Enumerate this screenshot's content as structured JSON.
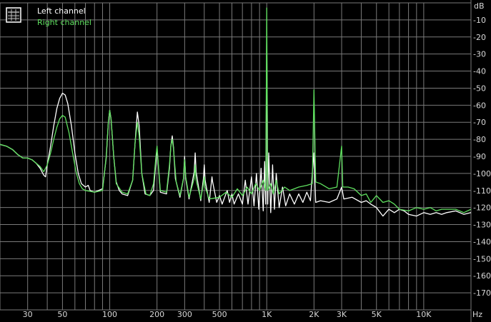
{
  "chart_data": {
    "type": "line",
    "xlabel": "Hz",
    "ylabel": "dB",
    "xscale": "log",
    "xlim": [
      20,
      20000
    ],
    "ylim": [
      -180,
      0
    ],
    "x_ticks": [
      {
        "value": 30,
        "label": "30"
      },
      {
        "value": 50,
        "label": "50"
      },
      {
        "value": 100,
        "label": "100"
      },
      {
        "value": 200,
        "label": "200"
      },
      {
        "value": 300,
        "label": "300"
      },
      {
        "value": 500,
        "label": "500"
      },
      {
        "value": 1000,
        "label": "1K"
      },
      {
        "value": 2000,
        "label": "2K"
      },
      {
        "value": 3000,
        "label": "3K"
      },
      {
        "value": 5000,
        "label": "5K"
      },
      {
        "value": 10000,
        "label": "10K"
      }
    ],
    "y_ticks": [
      -10,
      -20,
      -30,
      -40,
      -50,
      -60,
      -70,
      -80,
      -90,
      -100,
      -110,
      -120,
      -130,
      -140,
      -150,
      -160,
      -170
    ],
    "grid": true,
    "legend_position": "top-left",
    "legend_icon": "window-icon",
    "background_color": "#000000",
    "grid_color": "#7a7a7a",
    "series": [
      {
        "name": "Left channel",
        "color": "#ffffff",
        "points": [
          [
            20,
            -83
          ],
          [
            22,
            -84
          ],
          [
            24,
            -86
          ],
          [
            26,
            -89
          ],
          [
            28,
            -91
          ],
          [
            30,
            -91
          ],
          [
            32,
            -92
          ],
          [
            34,
            -94
          ],
          [
            36,
            -97
          ],
          [
            38,
            -101
          ],
          [
            39,
            -102
          ],
          [
            40,
            -95
          ],
          [
            42,
            -84
          ],
          [
            44,
            -72
          ],
          [
            46,
            -62
          ],
          [
            48,
            -56
          ],
          [
            50,
            -53
          ],
          [
            52,
            -54
          ],
          [
            54,
            -59
          ],
          [
            57,
            -72
          ],
          [
            60,
            -88
          ],
          [
            63,
            -100
          ],
          [
            66,
            -106
          ],
          [
            70,
            -108
          ],
          [
            73,
            -107
          ],
          [
            75,
            -110
          ],
          [
            80,
            -111
          ],
          [
            90,
            -109
          ],
          [
            95,
            -91
          ],
          [
            98,
            -70
          ],
          [
            100,
            -63
          ],
          [
            102,
            -68
          ],
          [
            106,
            -90
          ],
          [
            110,
            -105
          ],
          [
            115,
            -110
          ],
          [
            120,
            -112
          ],
          [
            130,
            -113
          ],
          [
            140,
            -104
          ],
          [
            145,
            -82
          ],
          [
            150,
            -64
          ],
          [
            154,
            -72
          ],
          [
            160,
            -100
          ],
          [
            168,
            -112
          ],
          [
            180,
            -113
          ],
          [
            190,
            -110
          ],
          [
            197,
            -93
          ],
          [
            200,
            -85
          ],
          [
            203,
            -93
          ],
          [
            210,
            -111
          ],
          [
            230,
            -112
          ],
          [
            240,
            -97
          ],
          [
            245,
            -84
          ],
          [
            250,
            -78
          ],
          [
            255,
            -85
          ],
          [
            262,
            -103
          ],
          [
            280,
            -114
          ],
          [
            295,
            -103
          ],
          [
            300,
            -90
          ],
          [
            305,
            -103
          ],
          [
            320,
            -115
          ],
          [
            345,
            -99
          ],
          [
            350,
            -88
          ],
          [
            355,
            -99
          ],
          [
            380,
            -116
          ],
          [
            395,
            -103
          ],
          [
            400,
            -95
          ],
          [
            405,
            -104
          ],
          [
            430,
            -117
          ],
          [
            448,
            -102
          ],
          [
            452,
            -105
          ],
          [
            480,
            -117
          ],
          [
            500,
            -113
          ],
          [
            520,
            -118
          ],
          [
            560,
            -110
          ],
          [
            580,
            -117
          ],
          [
            600,
            -112
          ],
          [
            620,
            -118
          ],
          [
            660,
            -112
          ],
          [
            700,
            -118
          ],
          [
            730,
            -104
          ],
          [
            760,
            -118
          ],
          [
            800,
            -102
          ],
          [
            830,
            -119
          ],
          [
            860,
            -100
          ],
          [
            890,
            -121
          ],
          [
            920,
            -97
          ],
          [
            950,
            -122
          ],
          [
            970,
            -93
          ],
          [
            985,
            -118
          ],
          [
            1000,
            -18
          ],
          [
            1015,
            -118
          ],
          [
            1030,
            -88
          ],
          [
            1060,
            -123
          ],
          [
            1090,
            -95
          ],
          [
            1120,
            -121
          ],
          [
            1150,
            -100
          ],
          [
            1200,
            -120
          ],
          [
            1260,
            -108
          ],
          [
            1320,
            -119
          ],
          [
            1400,
            -112
          ],
          [
            1500,
            -118
          ],
          [
            1600,
            -112
          ],
          [
            1700,
            -117
          ],
          [
            1800,
            -111
          ],
          [
            1900,
            -116
          ],
          [
            1950,
            -100
          ],
          [
            2000,
            -88
          ],
          [
            2050,
            -117
          ],
          [
            2200,
            -116
          ],
          [
            2500,
            -117
          ],
          [
            2800,
            -115
          ],
          [
            3000,
            -108
          ],
          [
            3100,
            -115
          ],
          [
            3500,
            -114
          ],
          [
            4000,
            -117
          ],
          [
            4300,
            -116
          ],
          [
            4600,
            -118
          ],
          [
            5000,
            -120
          ],
          [
            5500,
            -125
          ],
          [
            6000,
            -121
          ],
          [
            6500,
            -123
          ],
          [
            7000,
            -121
          ],
          [
            7500,
            -122
          ],
          [
            8000,
            -124
          ],
          [
            9000,
            -125
          ],
          [
            10000,
            -123
          ],
          [
            11000,
            -124
          ],
          [
            12000,
            -123
          ],
          [
            13000,
            -124
          ],
          [
            14000,
            -123
          ],
          [
            16000,
            -122
          ],
          [
            18000,
            -124
          ],
          [
            20000,
            -123
          ]
        ]
      },
      {
        "name": "Right channel",
        "color": "#5fe05f",
        "points": [
          [
            20,
            -83
          ],
          [
            22,
            -84
          ],
          [
            24,
            -86
          ],
          [
            26,
            -89
          ],
          [
            28,
            -91
          ],
          [
            30,
            -91
          ],
          [
            32,
            -92
          ],
          [
            34,
            -94
          ],
          [
            36,
            -96
          ],
          [
            38,
            -99
          ],
          [
            40,
            -95
          ],
          [
            42,
            -88
          ],
          [
            44,
            -80
          ],
          [
            46,
            -73
          ],
          [
            48,
            -68
          ],
          [
            50,
            -66
          ],
          [
            52,
            -67
          ],
          [
            55,
            -76
          ],
          [
            58,
            -88
          ],
          [
            61,
            -99
          ],
          [
            64,
            -106
          ],
          [
            67,
            -109
          ],
          [
            70,
            -110
          ],
          [
            80,
            -111
          ],
          [
            90,
            -110
          ],
          [
            95,
            -90
          ],
          [
            98,
            -70
          ],
          [
            100,
            -63
          ],
          [
            102,
            -68
          ],
          [
            106,
            -90
          ],
          [
            110,
            -106
          ],
          [
            120,
            -111
          ],
          [
            130,
            -112
          ],
          [
            140,
            -104
          ],
          [
            145,
            -82
          ],
          [
            150,
            -70
          ],
          [
            154,
            -78
          ],
          [
            160,
            -100
          ],
          [
            170,
            -112
          ],
          [
            180,
            -113
          ],
          [
            190,
            -106
          ],
          [
            197,
            -90
          ],
          [
            200,
            -84
          ],
          [
            203,
            -92
          ],
          [
            210,
            -110
          ],
          [
            230,
            -111
          ],
          [
            240,
            -95
          ],
          [
            245,
            -84
          ],
          [
            250,
            -80
          ],
          [
            255,
            -86
          ],
          [
            265,
            -105
          ],
          [
            280,
            -113
          ],
          [
            295,
            -103
          ],
          [
            300,
            -92
          ],
          [
            305,
            -102
          ],
          [
            320,
            -114
          ],
          [
            345,
            -103
          ],
          [
            350,
            -95
          ],
          [
            355,
            -104
          ],
          [
            380,
            -115
          ],
          [
            395,
            -106
          ],
          [
            400,
            -102
          ],
          [
            405,
            -108
          ],
          [
            430,
            -115
          ],
          [
            500,
            -114
          ],
          [
            550,
            -111
          ],
          [
            600,
            -114
          ],
          [
            650,
            -109
          ],
          [
            700,
            -113
          ],
          [
            750,
            -108
          ],
          [
            800,
            -112
          ],
          [
            850,
            -106
          ],
          [
            900,
            -110
          ],
          [
            950,
            -104
          ],
          [
            985,
            -110
          ],
          [
            1000,
            -3
          ],
          [
            1015,
            -110
          ],
          [
            1060,
            -106
          ],
          [
            1100,
            -112
          ],
          [
            1150,
            -104
          ],
          [
            1200,
            -112
          ],
          [
            1300,
            -108
          ],
          [
            1400,
            -110
          ],
          [
            1500,
            -109
          ],
          [
            1600,
            -108
          ],
          [
            1800,
            -107
          ],
          [
            1950,
            -106
          ],
          [
            2000,
            -51
          ],
          [
            2050,
            -105
          ],
          [
            2200,
            -106
          ],
          [
            2500,
            -109
          ],
          [
            2800,
            -108
          ],
          [
            3000,
            -84
          ],
          [
            3050,
            -108
          ],
          [
            3300,
            -108
          ],
          [
            3600,
            -109
          ],
          [
            4000,
            -113
          ],
          [
            4300,
            -112
          ],
          [
            4600,
            -117
          ],
          [
            5000,
            -113
          ],
          [
            5500,
            -117
          ],
          [
            6000,
            -116
          ],
          [
            6500,
            -118
          ],
          [
            7000,
            -121
          ],
          [
            8000,
            -122
          ],
          [
            9000,
            -120
          ],
          [
            10000,
            -121
          ],
          [
            11000,
            -120
          ],
          [
            12000,
            -122
          ],
          [
            13000,
            -121
          ],
          [
            14000,
            -121
          ],
          [
            16000,
            -121
          ],
          [
            18000,
            -123
          ],
          [
            20000,
            -121
          ]
        ]
      }
    ]
  }
}
